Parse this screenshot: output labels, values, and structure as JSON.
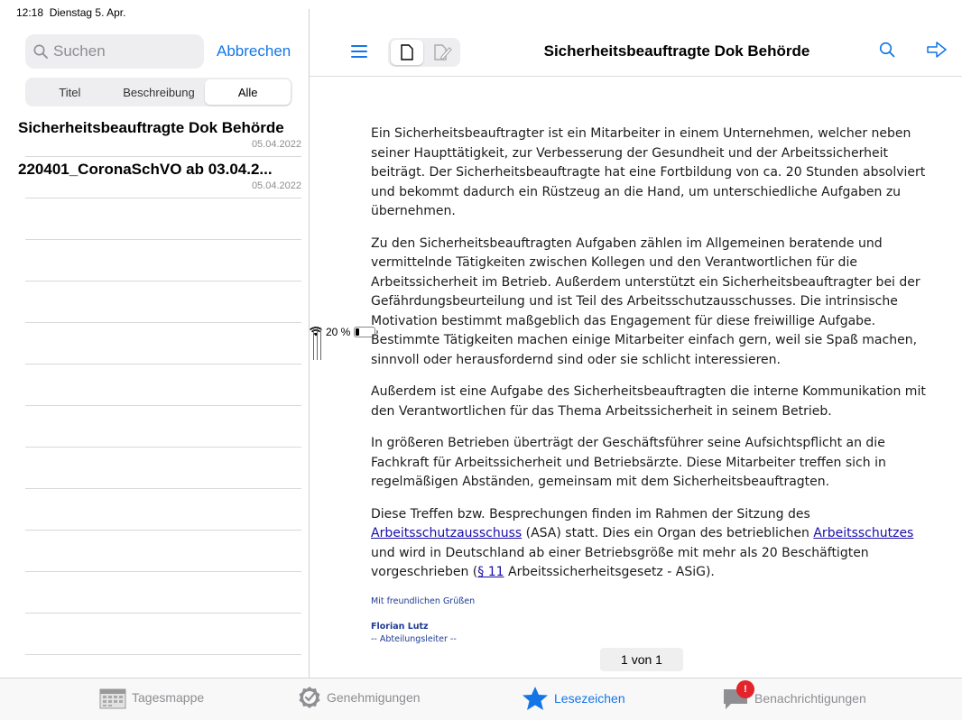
{
  "status": {
    "time": "12:18",
    "date": "Dienstag 5. Apr.",
    "battery": "20 %",
    "battery_level": 0.2
  },
  "sidebar": {
    "search_placeholder": "Suchen",
    "cancel_label": "Abbrechen",
    "segments": [
      "Titel",
      "Beschreibung",
      "Alle"
    ],
    "selected_segment": "Alle",
    "documents": [
      {
        "title": "Sicherheitsbeauftragte Dok Behörde",
        "date": "05.04.2022"
      },
      {
        "title": "220401_CoronaSchVO ab 03.04.2...",
        "date": "05.04.2022"
      }
    ]
  },
  "header": {
    "title": "Sicherheitsbeauftragte Dok Behörde"
  },
  "document": {
    "p1": "Ein Sicherheitsbeauftragter ist ein Mitarbeiter in einem Unternehmen, welcher neben seiner Haupttätigkeit, zur Verbesserung der Gesundheit und der Arbeitssicherheit beiträgt. Der Sicherheitsbeauftragte hat eine Fortbildung von ca. 20 Stunden absolviert und bekommt dadurch ein Rüstzeug an die Hand, um unterschiedliche Aufgaben zu übernehmen.",
    "p2": "Zu den Sicherheitsbeauftragten Aufgaben zählen im Allgemeinen beratende und vermittelnde Tätigkeiten zwischen Kollegen und den Verantwortlichen für die Arbeitssicherheit im Betrieb. Außerdem unterstützt ein Sicherheitsbeauftragter bei der Gefährdungsbeurteilung und ist Teil des Arbeitsschutzausschusses. Die intrinsische Motivation bestimmt maßgeblich das Engagement für diese freiwillige Aufgabe. Bestimmte Tätigkeiten machen einige Mitarbeiter einfach gern, weil sie Spaß machen, sinnvoll oder herausfordernd sind oder sie schlicht interessieren.",
    "p3": "Außerdem ist eine Aufgabe des Sicherheitsbeauftragten die interne Kommunikation mit den Verantwortlichen für das Thema Arbeitssicherheit in seinem Betrieb.",
    "p4": "In größeren Betrieben überträgt der Geschäftsführer seine Aufsichtspflicht an die Fachkraft für Arbeitssicherheit und Betriebsärzte. Diese Mitarbeiter treffen sich in regelmäßigen Abständen, gemeinsam mit dem Sicherheitsbeauftragten.",
    "p5_a": "Diese Treffen bzw. Besprechungen finden im Rahmen der Sitzung des ",
    "p5_link1": "Arbeitsschutzausschuss",
    "p5_b": " (ASA) statt. Dies ein Organ des betrieblichen ",
    "p5_link2": "Arbeitsschutzes",
    "p5_c": " und wird in Deutschland ab einer Betriebsgröße mit mehr als 20 Beschäftigten vorgeschrieben (",
    "p5_link3": "§ 11",
    "p5_d": " Arbeitssicherheitsgesetz - ASiG).",
    "greeting": "Mit freundlichen Grüßen",
    "signature_name": "Florian Lutz",
    "signature_role": "-- Abteilungsleiter --",
    "page_indicator": "1 von 1"
  },
  "tabbar": {
    "tabs": [
      {
        "label": "Tagesmappe",
        "icon": "calendar-icon"
      },
      {
        "label": "Genehmigungen",
        "icon": "checkmark-badge-icon"
      },
      {
        "label": "Lesezeichen",
        "icon": "star-icon"
      },
      {
        "label": "Benachrichtigungen",
        "icon": "speech-bubble-icon",
        "badge": "!"
      }
    ],
    "active_tab": "Lesezeichen"
  },
  "colors": {
    "accent": "#1476e6",
    "link": "#1a0dab",
    "badge": "#e3242b"
  }
}
